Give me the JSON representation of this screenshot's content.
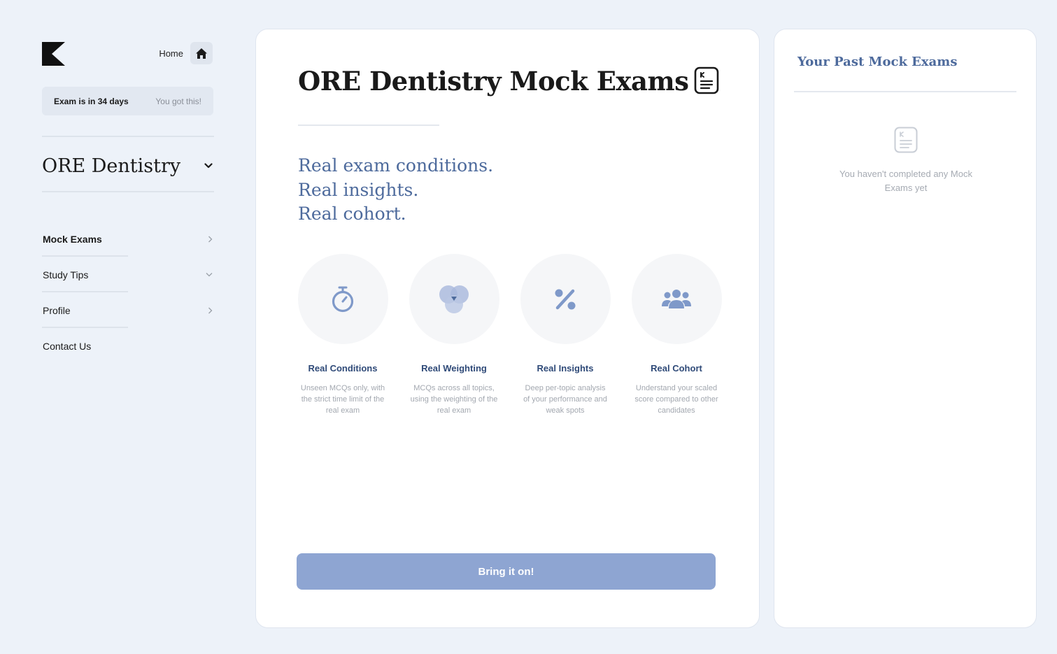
{
  "sidebar": {
    "home_label": "Home",
    "exam_countdown": "Exam is in 34 days",
    "encouragement": "You got this!",
    "course": "ORE Dentistry",
    "nav": [
      {
        "label": "Mock Exams",
        "active": true,
        "icon": "chevron-right-icon"
      },
      {
        "label": "Study Tips",
        "active": false,
        "icon": "chevron-down-icon"
      },
      {
        "label": "Profile",
        "active": false,
        "icon": "chevron-right-icon"
      },
      {
        "label": "Contact Us",
        "active": false,
        "icon": ""
      }
    ]
  },
  "main": {
    "title": "ORE Dentistry Mock Exams",
    "tagline": [
      "Real exam conditions.",
      "Real insights.",
      "Real cohort."
    ],
    "features": [
      {
        "icon": "stopwatch-icon",
        "title": "Real Conditions",
        "description": "Unseen MCQs only, with the strict time limit of the real exam"
      },
      {
        "icon": "venn-diagram-icon",
        "title": "Real Weighting",
        "description": "MCQs across all topics, using the weighting of the real exam"
      },
      {
        "icon": "percent-icon",
        "title": "Real Insights",
        "description": "Deep per-topic analysis of your performance and weak spots"
      },
      {
        "icon": "group-icon",
        "title": "Real Cohort",
        "description": "Understand your scaled score compared to other candidates"
      }
    ],
    "cta_label": "Bring it on!"
  },
  "past_exams": {
    "title": "Your Past Mock Exams",
    "empty_text": "You haven't completed any Mock Exams yet"
  },
  "colors": {
    "background": "#edf2f9",
    "accent_text": "#4d6a9c",
    "feature_title": "#2f4a78",
    "cta": "#8ea5d2",
    "icon": "#7f99c9"
  }
}
